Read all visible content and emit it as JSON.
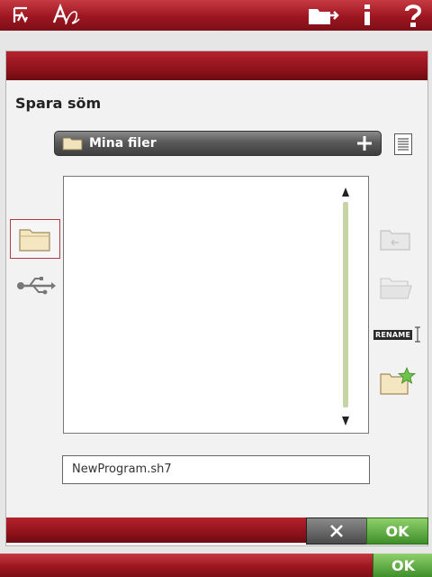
{
  "dialog": {
    "title": "Spara söm",
    "path": "Mina filer",
    "filename": "NewProgram.sh7",
    "rename_label": "RENAME",
    "ok_label": "OK"
  },
  "bottombar": {
    "ok_label": "OK"
  },
  "colors": {
    "accent_red": "#9c1620",
    "ok_green": "#4a9a32",
    "scroll_track": "#c7d4a6"
  }
}
